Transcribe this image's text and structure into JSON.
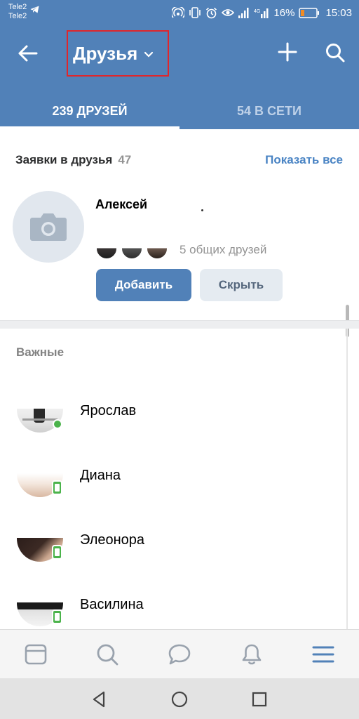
{
  "status_bar": {
    "carrier_1": "Tele2",
    "carrier_2": "Tele2",
    "network_type": "4G",
    "battery": "16%",
    "time": "15:03"
  },
  "header": {
    "title": "Друзья",
    "tabs": [
      {
        "label": "239 ДРУЗЕЙ",
        "active": true
      },
      {
        "label": "54 В СЕТИ",
        "active": false
      }
    ]
  },
  "requests": {
    "title": "Заявки в друзья",
    "count": "47",
    "show_all": "Показать все",
    "item": {
      "name": "Алексей",
      "mutual_friends": "5 общих друзей",
      "add_label": "Добавить",
      "hide_label": "Скрыть"
    }
  },
  "important": {
    "title": "Важные",
    "friends": [
      {
        "name": "Ярослав",
        "status": "online"
      },
      {
        "name": "Диана",
        "status": "mobile"
      },
      {
        "name": "Элеонора",
        "status": "mobile"
      },
      {
        "name": "Василина",
        "status": "mobile"
      }
    ]
  },
  "bottom_nav": [
    "news-icon",
    "search-icon",
    "messages-icon",
    "notifications-icon",
    "menu-icon"
  ],
  "colors": {
    "accent": "#5181b8",
    "link": "#4a84c4",
    "online": "#4bb34b"
  }
}
